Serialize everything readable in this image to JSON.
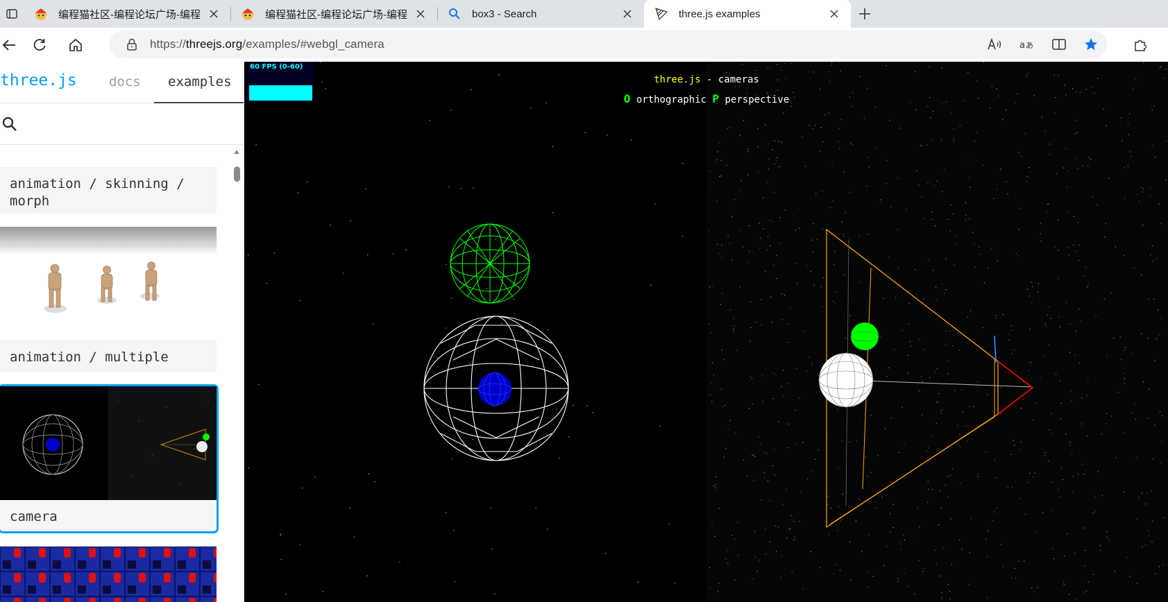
{
  "browser": {
    "tabs": [
      {
        "title": "编程猫社区-编程论坛广场-编程学",
        "favicon": "codemao-icon",
        "active": false
      },
      {
        "title": "编程猫社区-编程论坛广场-编程学",
        "favicon": "codemao-icon",
        "active": false
      },
      {
        "title": "box3 - Search",
        "favicon": "search-icon",
        "active": false
      },
      {
        "title": "three.js examples",
        "favicon": "threejs-icon",
        "active": true
      }
    ],
    "url_prefix": "https://",
    "url_host": "threejs.org",
    "url_path": "/examples/#webgl_camera"
  },
  "sidebar": {
    "brand": "three.js",
    "nav_docs": "docs",
    "nav_examples": "examples",
    "cards": [
      {
        "label": "animation / skinning / morph"
      },
      {
        "label": "animation / multiple"
      },
      {
        "label": "camera",
        "selected": true
      }
    ]
  },
  "viewport": {
    "stats": "60 FPS (0-60)",
    "info_brand": "three.js",
    "info_title": " - cameras",
    "key_o": "O",
    "label_o": " orthographic ",
    "key_p": "P",
    "label_p": " perspective"
  },
  "colors": {
    "accent": "#049ef4",
    "sphere_green": "#00ff00",
    "sphere_blue": "#0000ff",
    "frustum": "#ffaa00"
  }
}
